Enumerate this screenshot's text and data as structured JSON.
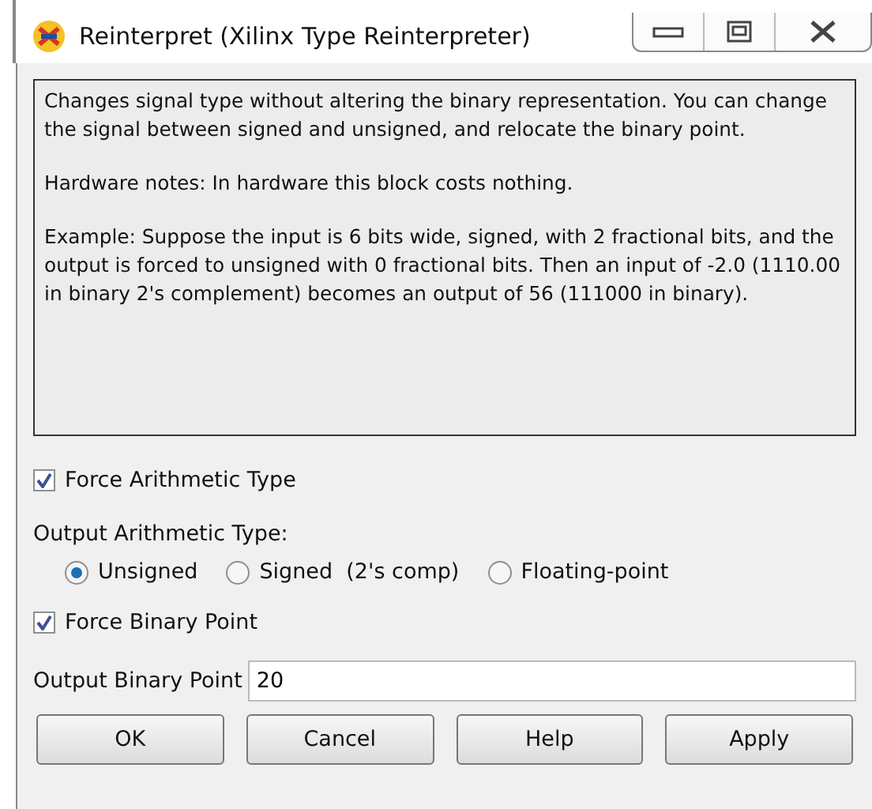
{
  "window": {
    "title": "Reinterpret (Xilinx Type Reinterpreter)"
  },
  "description": [
    "Changes signal type without altering the binary representation. You can change the signal between signed and unsigned, and relocate the binary point.",
    "Hardware notes: In hardware this block costs nothing.",
    "Example: Suppose the input is 6 bits wide, signed, with 2 fractional bits, and the output is forced to unsigned with 0 fractional bits. Then an input of -2.0 (1110.00 in binary 2's complement) becomes an output of 56 (111000 in binary)."
  ],
  "force_arithmetic_type": {
    "label": "Force Arithmetic Type",
    "checked": true
  },
  "output_arithmetic_type": {
    "label": "Output Arithmetic Type:",
    "options": [
      {
        "label": "Unsigned",
        "selected": true
      },
      {
        "label": "Signed  (2's comp)",
        "selected": false
      },
      {
        "label": "Floating-point",
        "selected": false
      }
    ]
  },
  "force_binary_point": {
    "label": "Force Binary Point",
    "checked": true
  },
  "output_binary_point": {
    "label": "Output Binary Point",
    "value": "20"
  },
  "buttons": [
    "OK",
    "Cancel",
    "Help",
    "Apply"
  ]
}
